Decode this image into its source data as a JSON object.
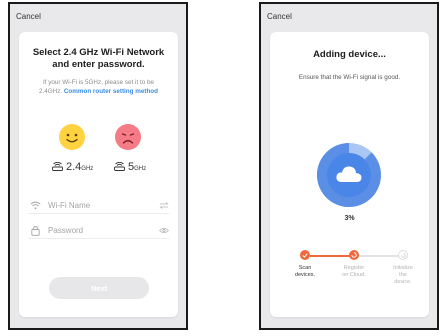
{
  "screen1": {
    "cancel_label": "Cancel",
    "title_line1": "Select 2.4 GHz Wi-Fi Network",
    "title_line2": "and enter password.",
    "hint_line1": "If your Wi-Fi is 5GHz, please set it to be",
    "hint_line2_prefix": "2.4GHz. ",
    "hint_link": "Common router setting method",
    "band_good_value": "2.4",
    "band_good_unit": "GHz",
    "band_bad_value": "5",
    "band_bad_unit": "GHz",
    "wifi_placeholder": "Wi-Fi Name",
    "password_placeholder": "Password",
    "next_label": "Next"
  },
  "screen2": {
    "cancel_label": "Cancel",
    "title": "Adding device...",
    "subtitle": "Ensure that the Wi-Fi signal is good.",
    "progress_percent": "3%",
    "progress_value": 0.03,
    "steps": [
      {
        "label_line1": "Scan",
        "label_line2": "devices.",
        "state": "done"
      },
      {
        "label_line1": "Register",
        "label_line2": "on Cloud.",
        "state": "active"
      },
      {
        "label_line1": "Initialize",
        "label_line2": "the",
        "label_line3": "device.",
        "state": "pending"
      }
    ]
  },
  "colors": {
    "accent_orange": "#f0693c",
    "link_blue": "#3a8de6",
    "ring_blue": "#5b8fe6",
    "ring_light": "#a9c6f4",
    "smiley_yellow": "#ffd23f",
    "sad_pink": "#f57b86"
  },
  "icons": {
    "good_face": "smiley-face-icon",
    "bad_face": "sad-face-icon",
    "router": "router-icon",
    "wifi": "wifi-icon",
    "lock": "lock-icon",
    "switch": "switch-network-icon",
    "eye": "eye-icon",
    "cloud": "cloud-icon",
    "check": "check-icon"
  }
}
